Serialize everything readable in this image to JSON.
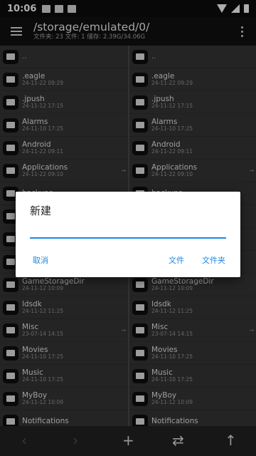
{
  "statusbar": {
    "time": "10:06"
  },
  "toolbar": {
    "path": "/storage/emulated/0/",
    "subinfo": "文件夹: 23  文件: 1  储存: 2.39G/34.06G"
  },
  "left": [
    {
      "name": "..",
      "date": ""
    },
    {
      "name": ".eagle",
      "date": "24-11-22 09:29"
    },
    {
      "name": ".jpush",
      "date": "24-11-12 17:15"
    },
    {
      "name": "Alarms",
      "date": "24-11-10 17:25"
    },
    {
      "name": "Android",
      "date": "24-11-22 09:11"
    },
    {
      "name": "Applications",
      "date": "24-11-22 09:10",
      "arrow": "→"
    },
    {
      "name": "backups",
      "date": ""
    },
    {
      "name": "",
      "date": ""
    },
    {
      "name": "",
      "date": ""
    },
    {
      "name": "",
      "date": ""
    },
    {
      "name": "GameStorageDir",
      "date": "24-11-12 10:09"
    },
    {
      "name": "ldsdk",
      "date": "24-11-12 11:25"
    },
    {
      "name": "Misc",
      "date": "23-07-14 14:15",
      "arrow": "→"
    },
    {
      "name": "Movies",
      "date": "24-11-10 17:25"
    },
    {
      "name": "Music",
      "date": "24-11-10 17:25"
    },
    {
      "name": "MyBoy",
      "date": "24-11-12 10:09"
    },
    {
      "name": "Notifications",
      "date": ""
    }
  ],
  "right": [
    {
      "name": "..",
      "date": ""
    },
    {
      "name": ".eagle",
      "date": "24-11-22 09:29"
    },
    {
      "name": ".jpush",
      "date": "24-11-12 17:15"
    },
    {
      "name": "Alarms",
      "date": "24-11-10 17:25"
    },
    {
      "name": "Android",
      "date": "24-11-22 09:11"
    },
    {
      "name": "Applications",
      "date": "24-11-22 09:10",
      "arrow": "→"
    },
    {
      "name": "backups",
      "date": ""
    },
    {
      "name": "",
      "date": ""
    },
    {
      "name": "",
      "date": ""
    },
    {
      "name": "",
      "date": ""
    },
    {
      "name": "GameStorageDir",
      "date": "24-11-12 10:09"
    },
    {
      "name": "ldsdk",
      "date": "24-11-12 11:25"
    },
    {
      "name": "Misc",
      "date": "23-07-14 14:15",
      "arrow": "→"
    },
    {
      "name": "Movies",
      "date": "24-11-10 17:25"
    },
    {
      "name": "Music",
      "date": "24-11-10 17:25"
    },
    {
      "name": "MyBoy",
      "date": "24-11-12 10:09"
    },
    {
      "name": "Notifications",
      "date": ""
    }
  ],
  "dialog": {
    "title": "新建",
    "input_value": "",
    "cancel": "取消",
    "file": "文件",
    "folder": "文件夹"
  },
  "bottombar": {
    "back": "‹",
    "forward": "›",
    "add": "+",
    "swap": "⇄",
    "up": "↑"
  }
}
